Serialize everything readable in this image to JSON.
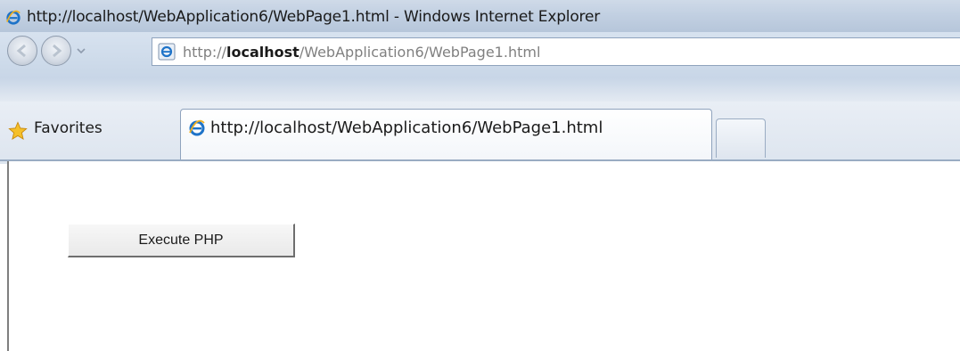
{
  "window": {
    "title": "http://localhost/WebApplication6/WebPage1.html - Windows Internet Explorer",
    "icon": "ie-icon"
  },
  "navigation": {
    "back_icon": "back-arrow-icon",
    "forward_icon": "forward-arrow-icon",
    "address": {
      "prefix": "http://",
      "host": "localhost",
      "path": "/WebApplication6/WebPage1.html"
    }
  },
  "favorites": {
    "label": "Favorites",
    "icon": "star-icon"
  },
  "tabs": [
    {
      "label": "http://localhost/WebApplication6/WebPage1.html",
      "icon": "ie-icon"
    }
  ],
  "page": {
    "button_label": "Execute PHP"
  },
  "colors": {
    "chrome": "#c8d6e7",
    "tab_border": "#8fa3bd",
    "ie_blue": "#1e73c8"
  }
}
